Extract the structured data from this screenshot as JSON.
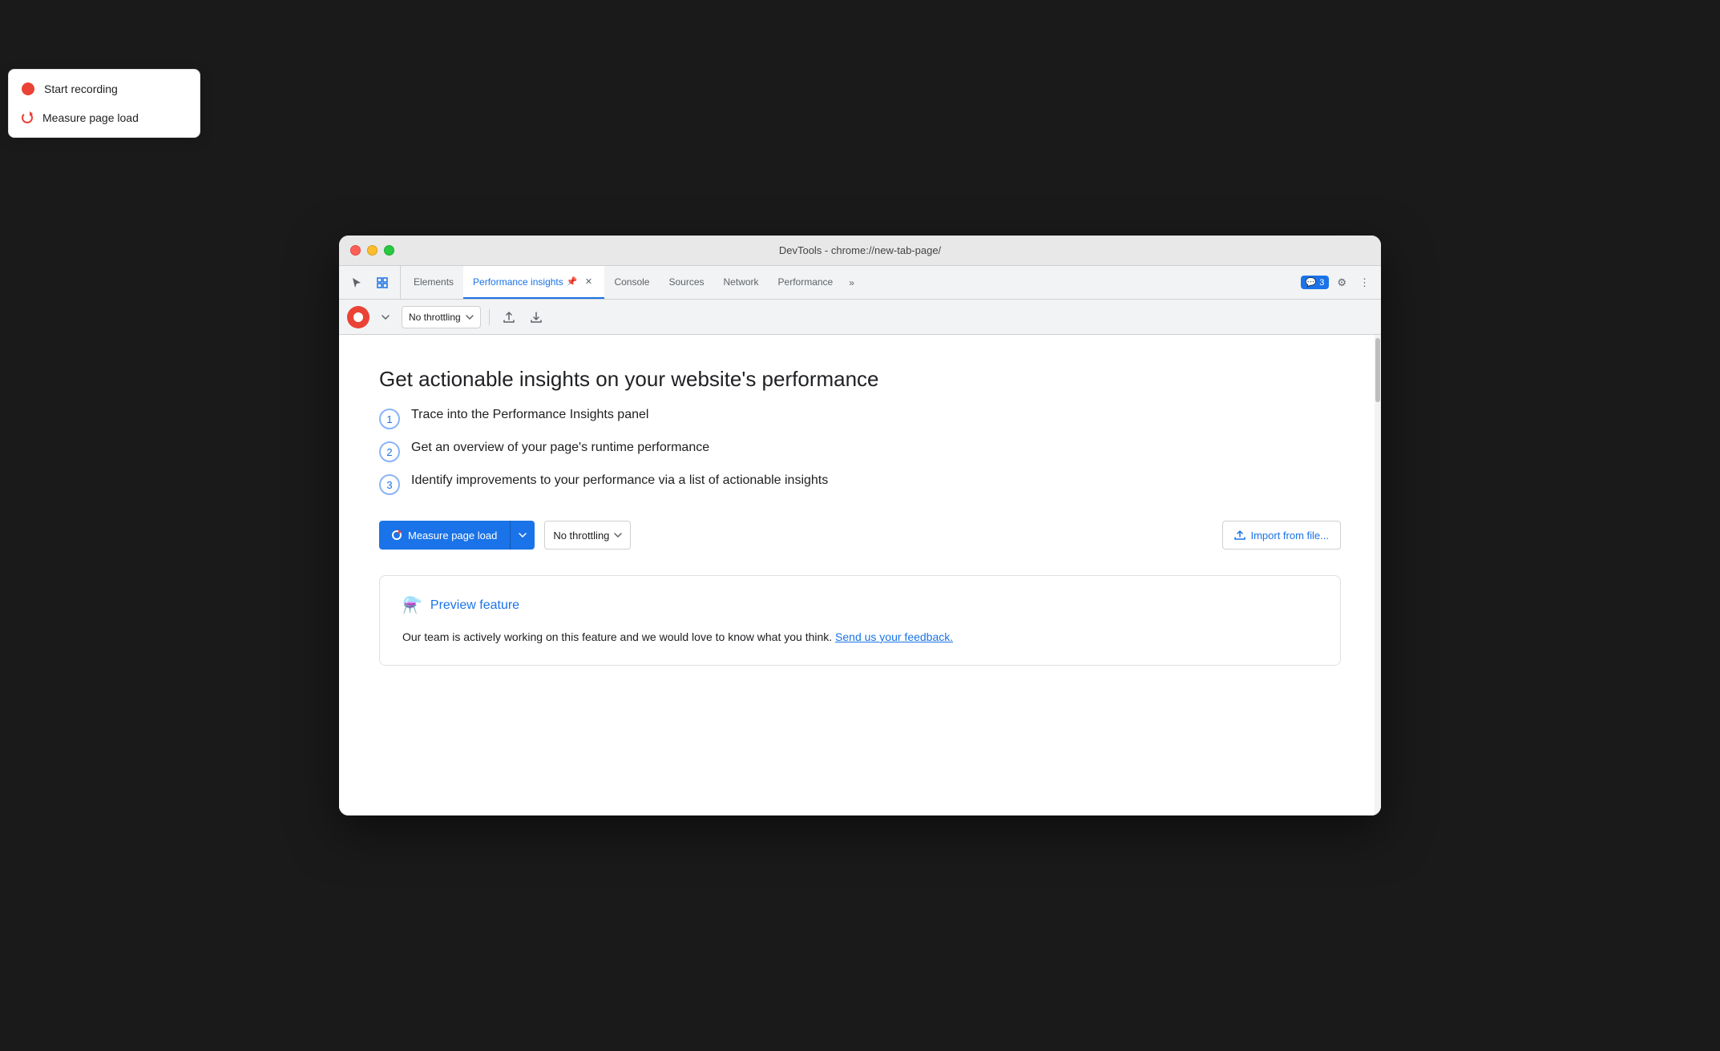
{
  "window": {
    "title": "DevTools - chrome://new-tab-page/"
  },
  "tabs": {
    "items": [
      {
        "label": "Elements",
        "active": false,
        "closable": false
      },
      {
        "label": "Performance insights",
        "active": true,
        "closable": true,
        "has_pin": true
      },
      {
        "label": "Console",
        "active": false,
        "closable": false
      },
      {
        "label": "Sources",
        "active": false,
        "closable": false
      },
      {
        "label": "Network",
        "active": false,
        "closable": false
      },
      {
        "label": "Performance",
        "active": false,
        "closable": false
      }
    ],
    "overflow_label": "»",
    "feedback_badge": "💬 3",
    "settings_icon": "⚙",
    "more_icon": "⋮"
  },
  "toolbar": {
    "throttle_label": "No throttling",
    "upload_icon": "↑",
    "download_icon": "↓"
  },
  "dropdown": {
    "items": [
      {
        "label": "Start recording",
        "type": "record"
      },
      {
        "label": "Measure page load",
        "type": "reload"
      }
    ]
  },
  "main": {
    "heading": "Get actionable insights on your website's performance",
    "steps": [
      {
        "num": "1",
        "text": "Trace into the Performance Insights panel"
      },
      {
        "num": "2",
        "text": "Get an overview of your page's runtime performance"
      },
      {
        "num": "3",
        "text": "Identify improvements to your performance via a list of actionable insights"
      }
    ],
    "measure_btn_label": "Measure page load",
    "throttle_label": "No throttling",
    "import_btn_label": "Import from file...",
    "preview_card": {
      "title": "Preview feature",
      "body_text": "Our team is actively working on this feature and we would love to know what you think.",
      "feedback_link_text": "Send us your feedback."
    }
  }
}
